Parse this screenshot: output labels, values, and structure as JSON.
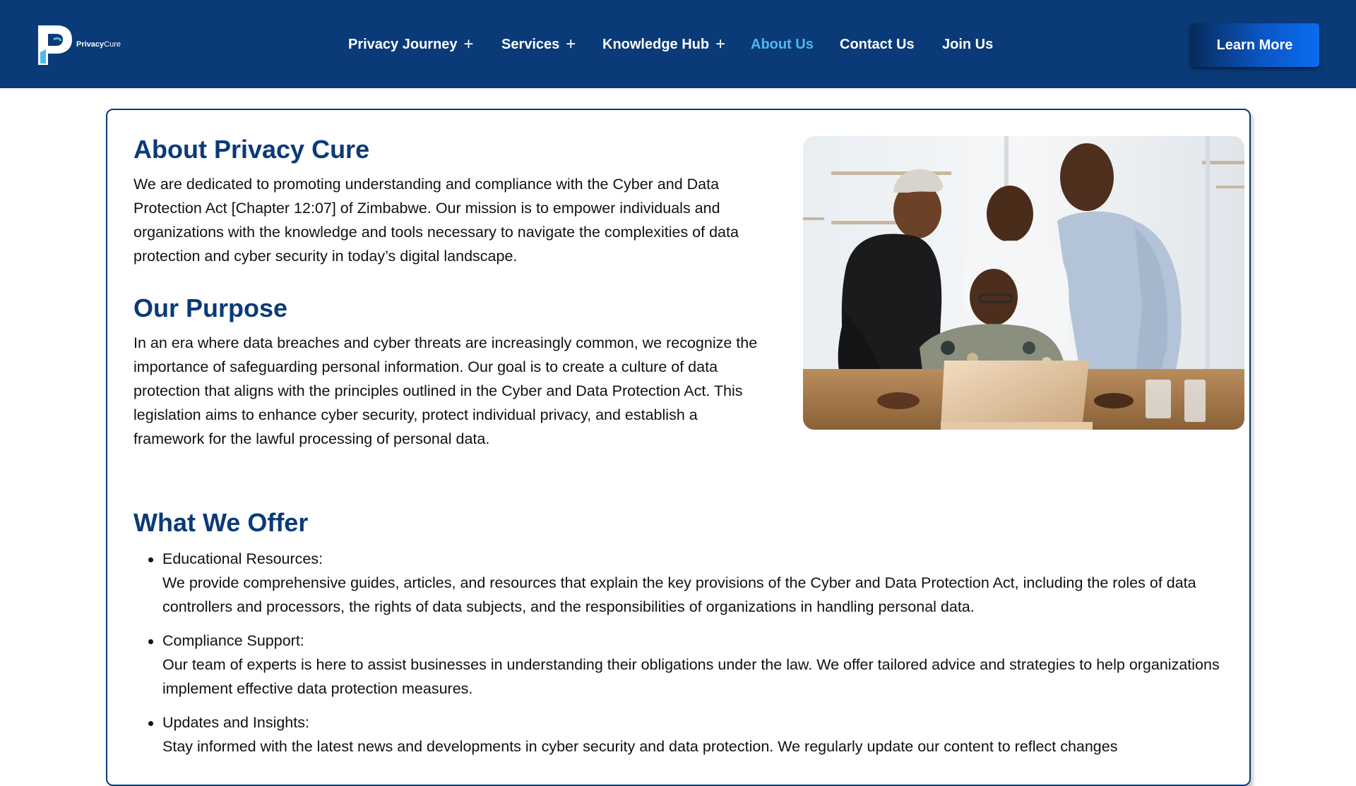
{
  "brand": {
    "name_bold": "Privacy",
    "name_regular": "Cure",
    "logo_letter": "P"
  },
  "nav": {
    "items": [
      {
        "label": "Privacy Journey",
        "has_submenu": true,
        "active": false
      },
      {
        "label": "Services",
        "has_submenu": true,
        "active": false
      },
      {
        "label": "Knowledge Hub",
        "has_submenu": true,
        "active": false
      },
      {
        "label": "About Us",
        "has_submenu": false,
        "active": true
      },
      {
        "label": "Contact Us",
        "has_submenu": false,
        "active": false
      },
      {
        "label": "Join Us",
        "has_submenu": false,
        "active": false
      }
    ],
    "submenu_glyph": "+",
    "cta_label": "Learn More"
  },
  "about": {
    "title": "About Privacy Cure",
    "text": "We are dedicated to promoting understanding and compliance with the Cyber and Data Protection Act [Chapter 12:07] of Zimbabwe. Our mission is to empower individuals and organizations with the knowledge and tools necessary to navigate the complexities of data protection and cyber security in today’s digital landscape."
  },
  "purpose": {
    "title": "Our Purpose",
    "text": "In an era where data breaches and cyber threats are increasingly common, we recognize the importance of safeguarding personal information. Our goal is to create a culture of data protection that aligns with the principles outlined in the Cyber and Data Protection Act. This legislation aims to enhance cyber security, protect individual privacy, and establish a framework for the lawful processing of personal data."
  },
  "offer": {
    "title": "What We Offer",
    "items": [
      {
        "title": "Educational Resources:",
        "text": "We provide comprehensive guides, articles, and resources that explain the key provisions of the Cyber and Data Protection Act, including the roles of data controllers and processors, the rights of data subjects, and the responsibilities of organizations in handling personal data."
      },
      {
        "title": "Compliance Support:",
        "text": "Our team of experts is here to assist businesses in understanding their obligations under the law. We offer tailored advice and strategies to help organizations implement effective data protection measures."
      },
      {
        "title": "Updates and Insights:",
        "text": "Stay informed with the latest news and developments in cyber security and data protection. We regularly update our content to reflect changes"
      }
    ]
  },
  "colors": {
    "header_bg": "#0a3a78",
    "heading": "#0a3a78",
    "active_nav": "#4fb8ee",
    "cta_gradient_start": "#072a5a",
    "cta_gradient_end": "#0a6cf0"
  },
  "icons": {
    "logo": "privacycure-p-logo-icon",
    "submenu": "plus-icon",
    "bullet": "bullet-dot-icon"
  }
}
